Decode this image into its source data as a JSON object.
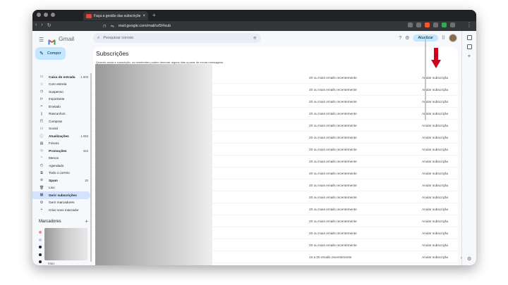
{
  "browser": {
    "tab_title": "Faça a gestão das subscrições",
    "url": "mail.google.com/mail/u/0/#sub"
  },
  "gmail": {
    "app_name": "Gmail",
    "search_placeholder": "Pesquisar correio",
    "update_button": "Atualizar",
    "compose_label": "Compor",
    "nav": [
      {
        "icon": "inbox-icon",
        "glyph": "▭",
        "label": "Caixa de entrada",
        "count": "1.503",
        "bold": true
      },
      {
        "icon": "star-icon",
        "glyph": "☆",
        "label": "Com estrela",
        "count": "",
        "bold": false
      },
      {
        "icon": "clock-icon",
        "glyph": "◷",
        "label": "Suspenso",
        "count": "",
        "bold": false
      },
      {
        "icon": "important-icon",
        "glyph": "ᐅ",
        "label": "Importante",
        "count": "",
        "bold": false
      },
      {
        "icon": "send-icon",
        "glyph": "➢",
        "label": "Enviado",
        "count": "",
        "bold": false
      },
      {
        "icon": "draft-icon",
        "glyph": "▯",
        "label": "Rascunhos",
        "count": "",
        "bold": false
      },
      {
        "icon": "purchases-icon",
        "glyph": "◰",
        "label": "Compras",
        "count": "",
        "bold": false
      },
      {
        "icon": "social-icon",
        "glyph": "⚇",
        "label": "Social",
        "count": "",
        "bold": false
      },
      {
        "icon": "info-icon",
        "glyph": "ⓘ",
        "label": "Atualizações",
        "count": "1.553",
        "bold": true
      },
      {
        "icon": "forum-icon",
        "glyph": "▤",
        "label": "Fóruns",
        "count": "",
        "bold": false
      },
      {
        "icon": "tag-icon",
        "glyph": "◇",
        "label": "Promoções",
        "count": "344",
        "bold": true
      },
      {
        "icon": "chevron-up-icon",
        "glyph": "⌃",
        "label": "Menos",
        "count": "",
        "bold": false
      },
      {
        "icon": "scheduled-icon",
        "glyph": "◴",
        "label": "Agendado",
        "count": "",
        "bold": false
      },
      {
        "icon": "all-mail-icon",
        "glyph": "⧉",
        "label": "Todo o correio",
        "count": "",
        "bold": false
      },
      {
        "icon": "spam-icon",
        "glyph": "⊘",
        "label": "Spam",
        "count": "20",
        "bold": true
      },
      {
        "icon": "trash-icon",
        "glyph": "🗑",
        "label": "Lixo",
        "count": "",
        "bold": false
      },
      {
        "icon": "subscriptions-icon",
        "glyph": "▦",
        "label": "Gerir subscrições",
        "count": "",
        "bold": false,
        "active": true
      },
      {
        "icon": "gear-icon",
        "glyph": "⚙",
        "label": "Gerir marcadores",
        "count": "",
        "bold": false
      },
      {
        "icon": "plus-icon",
        "glyph": "+",
        "label": "Criar novo marcador",
        "count": "",
        "bold": false
      }
    ],
    "labels_heading": "Marcadores",
    "label_colors": [
      "#f28b82",
      "#aecbfa",
      "#202124",
      "#202124",
      "#202124",
      "#4285f4"
    ],
    "labels_more": "Mais"
  },
  "subscriptions": {
    "title": "Subscrições",
    "description": "Quando anula a subscrição, os remetentes podem demorar alguns dias a parar de enviar mensagens",
    "rows": [
      {
        "count": "20 ou mais emails recentemente",
        "action": "Anular subscrição"
      },
      {
        "count": "20 ou mais emails recentemente",
        "action": "Anular subscrição"
      },
      {
        "count": "20 ou mais emails recentemente",
        "action": "Anular subscrição"
      },
      {
        "count": "20 ou mais emails recentemente",
        "action": "Anular subscrição"
      },
      {
        "count": "20 ou mais emails recentemente",
        "action": "Anular subscrição"
      },
      {
        "count": "20 ou mais emails recentemente",
        "action": "Anular subscrição"
      },
      {
        "count": "20 ou mais emails recentemente",
        "action": "Anular subscrição"
      },
      {
        "count": "20 ou mais emails recentemente",
        "action": "Anular subscrição"
      },
      {
        "count": "20 ou mais emails recentemente",
        "action": "Anular subscrição"
      },
      {
        "count": "20 ou mais emails recentemente",
        "action": "Anular subscrição"
      },
      {
        "count": "20 ou mais emails recentemente",
        "action": "Anular subscrição"
      },
      {
        "count": "20 ou mais emails recentemente",
        "action": "Anular subscrição"
      },
      {
        "count": "20 ou mais emails recentemente",
        "action": "Anular subscrição"
      },
      {
        "count": "20 ou mais emails recentemente",
        "action": "Anular subscrição"
      },
      {
        "count": "20 ou mais emails recentemente",
        "action": "Anular subscrição"
      },
      {
        "count": "10 a 20 emails recentemente",
        "action": "Anular subscrição"
      }
    ]
  },
  "annotation": {
    "arrow_color": "#d0021b"
  }
}
